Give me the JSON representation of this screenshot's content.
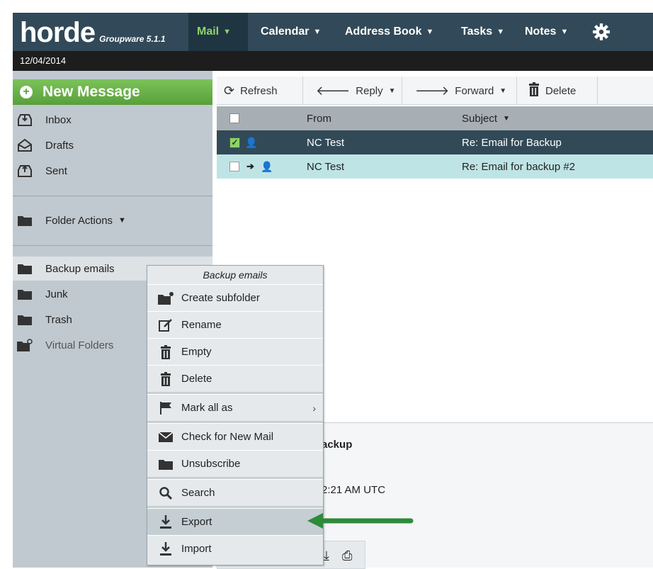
{
  "app": {
    "logo": "horde",
    "product": "Groupware 5.1.1",
    "date": "12/04/2014"
  },
  "nav": {
    "mail": "Mail",
    "calendar": "Calendar",
    "address_book": "Address Book",
    "tasks": "Tasks",
    "notes": "Notes"
  },
  "sidebar": {
    "new_message": "New Message",
    "folders": [
      "Inbox",
      "Drafts",
      "Sent"
    ],
    "folder_actions": "Folder Actions",
    "user_folders": [
      "Backup emails",
      "Junk",
      "Trash",
      "Virtual Folders"
    ]
  },
  "toolbar": {
    "refresh": "Refresh",
    "reply": "Reply",
    "forward": "Forward",
    "delete": "Delete"
  },
  "list": {
    "headers": {
      "from": "From",
      "subject": "Subject"
    },
    "rows": [
      {
        "from": "NC Test",
        "subject": "Re: Email for Backup",
        "selected": true
      },
      {
        "from": "NC Test",
        "subject": "Re: Email for backup #2",
        "selected": false
      }
    ]
  },
  "preview": {
    "subject_fragment": "ackup",
    "date_fragment": "2:21 AM UTC"
  },
  "context_menu": {
    "title": "Backup emails",
    "items": [
      "Create subfolder",
      "Rename",
      "Empty",
      "Delete",
      "Mark all as",
      "Check for New Mail",
      "Unsubscribe",
      "Search",
      "Export",
      "Import"
    ],
    "highlighted": "Export"
  },
  "colors": {
    "nav_bg": "#314958",
    "accent_green": "#58a03a",
    "selected_row": "#324a58",
    "unread_row": "#bfe4e6",
    "annotation_arrow": "#2e8b3a"
  }
}
